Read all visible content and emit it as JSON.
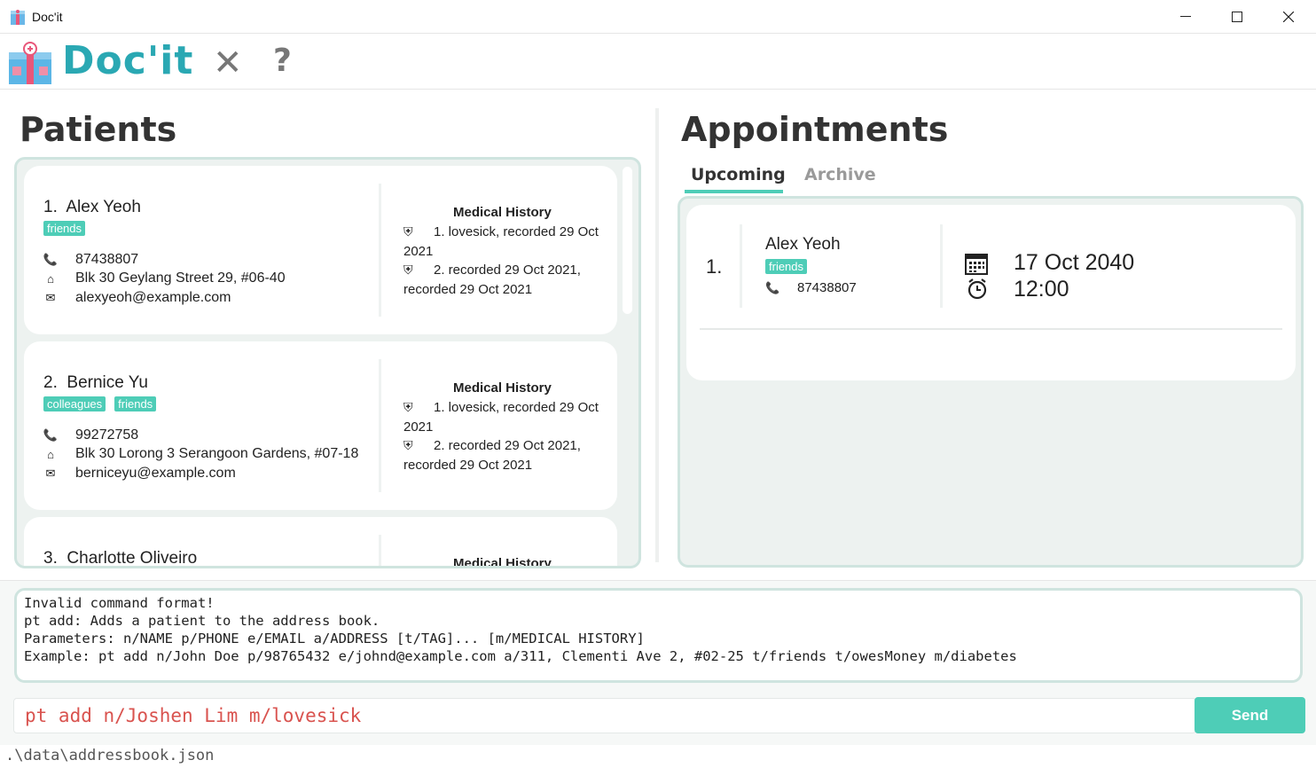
{
  "window": {
    "title": "Doc'it",
    "min_icon": "minimize-icon",
    "max_icon": "maximize-icon",
    "close_icon": "close-icon"
  },
  "toolbar": {
    "brand": "Doc'it",
    "close_glyph": "✕",
    "help_glyph": "?"
  },
  "patients": {
    "heading": "Patients",
    "list": [
      {
        "index": "1.",
        "name": "Alex Yeoh",
        "tags": [
          "friends"
        ],
        "phone": "87438807",
        "address": "Blk 30 Geylang Street 29, #06-40",
        "email": "alexyeoh@example.com",
        "history_title": "Medical History",
        "history": [
          "1. lovesick, recorded 29 Oct 2021",
          "2. recorded 29 Oct 2021, recorded 29 Oct 2021"
        ]
      },
      {
        "index": "2.",
        "name": "Bernice Yu",
        "tags": [
          "colleagues",
          "friends"
        ],
        "phone": "99272758",
        "address": "Blk 30 Lorong 3 Serangoon Gardens, #07-18",
        "email": "berniceyu@example.com",
        "history_title": "Medical History",
        "history": [
          "1. lovesick, recorded 29 Oct 2021",
          "2. recorded 29 Oct 2021, recorded 29 Oct 2021"
        ]
      },
      {
        "index": "3.",
        "name": "Charlotte Oliveiro",
        "history_title": "Medical History"
      }
    ]
  },
  "appointments": {
    "heading": "Appointments",
    "tabs": [
      "Upcoming",
      "Archive"
    ],
    "active_tab": "Upcoming",
    "list": [
      {
        "index": "1.",
        "name": "Alex Yeoh",
        "tag": "friends",
        "phone": "87438807",
        "date": "17 Oct 2040",
        "time": "12:00"
      }
    ]
  },
  "result": {
    "text": "Invalid command format!\npt add: Adds a patient to the address book.\nParameters: n/NAME p/PHONE e/EMAIL a/ADDRESS [t/TAG]... [m/MEDICAL HISTORY]\nExample: pt add n/John Doe p/98765432 e/johnd@example.com a/311, Clementi Ave 2, #02-25 t/friends t/owesMoney m/diabetes"
  },
  "command": {
    "value": "pt add n/Joshen Lim m/lovesick",
    "send_label": "Send"
  },
  "status": {
    "path": ".\\data\\addressbook.json"
  },
  "colors": {
    "accent": "#4ecdb7",
    "brand": "#2aa8b3",
    "panel_bg": "#edf2f0",
    "panel_border": "#cfe4df",
    "command_text": "#d9534f"
  }
}
